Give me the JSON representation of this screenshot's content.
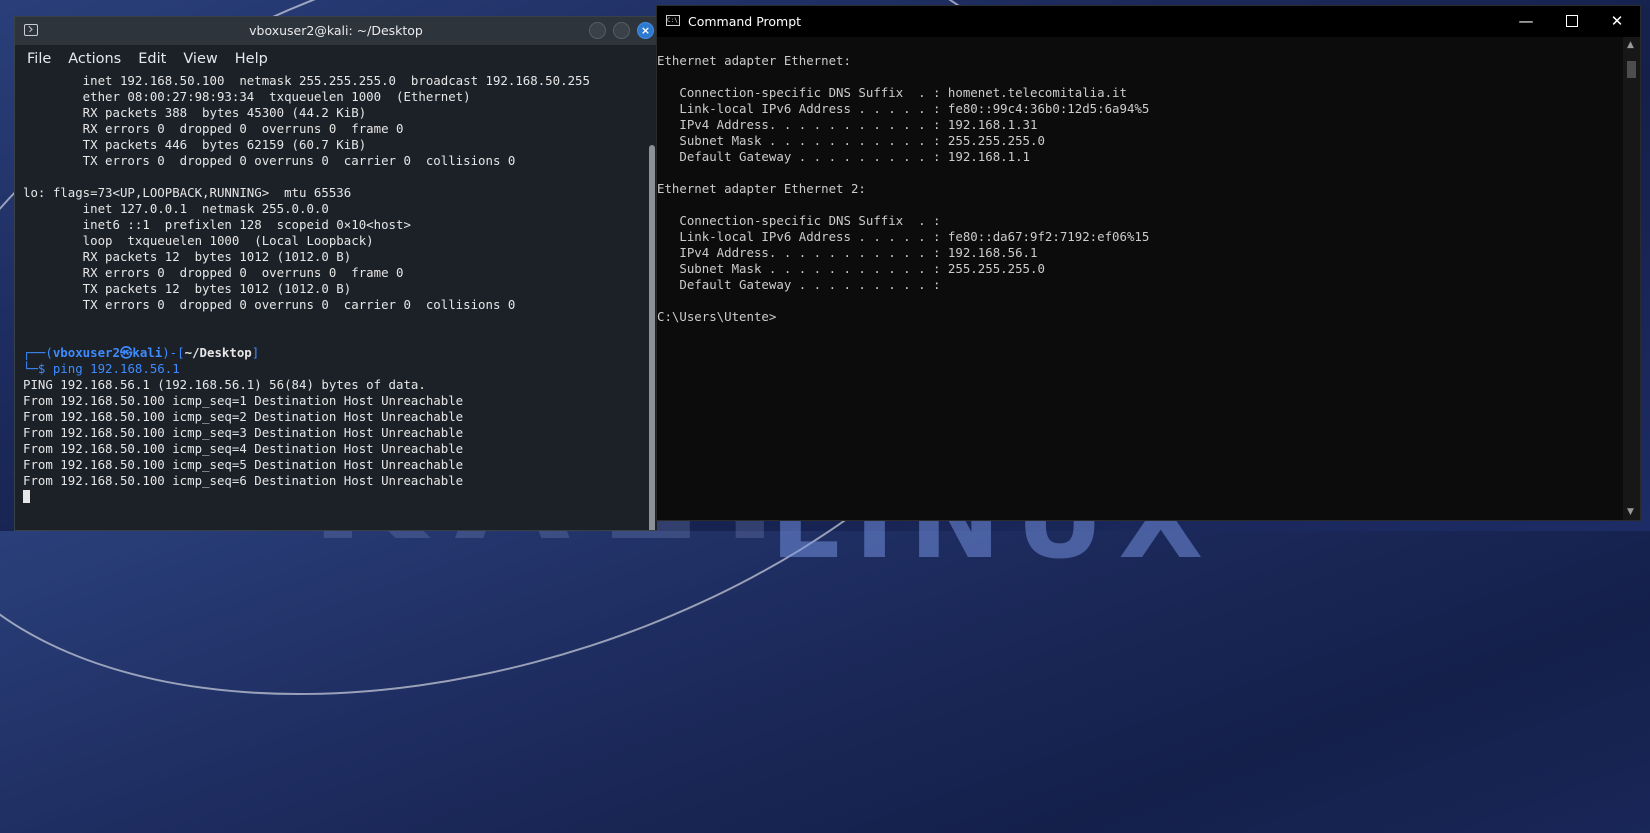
{
  "colors": {
    "kali_prompt_blue": "#3d8bff",
    "cmd_text": "#cccccc",
    "kali_bg": "#1c2128"
  },
  "desktop": {
    "brand_text": "KALI",
    "brand_text_2": "LINUX"
  },
  "kali_terminal": {
    "title": "vboxuser2@kali: ~/Desktop",
    "menu": [
      "File",
      "Actions",
      "Edit",
      "View",
      "Help"
    ],
    "lines": [
      "        inet 192.168.50.100  netmask 255.255.255.0  broadcast 192.168.50.255",
      "        ether 08:00:27:98:93:34  txqueuelen 1000  (Ethernet)",
      "        RX packets 388  bytes 45300 (44.2 KiB)",
      "        RX errors 0  dropped 0  overruns 0  frame 0",
      "        TX packets 446  bytes 62159 (60.7 KiB)",
      "        TX errors 0  dropped 0 overruns 0  carrier 0  collisions 0",
      "",
      "lo: flags=73<UP,LOOPBACK,RUNNING>  mtu 65536",
      "        inet 127.0.0.1  netmask 255.0.0.0",
      "        inet6 ::1  prefixlen 128  scopeid 0×10<host>",
      "        loop  txqueuelen 1000  (Local Loopback)",
      "        RX packets 12  bytes 1012 (1012.0 B)",
      "        RX errors 0  dropped 0  overruns 0  frame 0",
      "        TX packets 12  bytes 1012 (1012.0 B)",
      "        TX errors 0  dropped 0 overruns 0  carrier 0  collisions 0",
      "",
      ""
    ],
    "prompt": {
      "open": "┌──(",
      "user_host": "vboxuser2㉿kali",
      "mid": ")-[",
      "path": "~/Desktop",
      "close": "]",
      "line2": "└─$ ",
      "command": "ping 192.168.56.1"
    },
    "output": [
      "PING 192.168.56.1 (192.168.56.1) 56(84) bytes of data.",
      "From 192.168.50.100 icmp_seq=1 Destination Host Unreachable",
      "From 192.168.50.100 icmp_seq=2 Destination Host Unreachable",
      "From 192.168.50.100 icmp_seq=3 Destination Host Unreachable",
      "From 192.168.50.100 icmp_seq=4 Destination Host Unreachable",
      "From 192.168.50.100 icmp_seq=5 Destination Host Unreachable",
      "From 192.168.50.100 icmp_seq=6 Destination Host Unreachable"
    ]
  },
  "cmd": {
    "title": "Command Prompt",
    "icon_text": "C:\\",
    "controls": {
      "minimize": "—",
      "close": "✕"
    },
    "scroll_up": "▲",
    "scroll_down": "▼",
    "lines": [
      "Ethernet adapter Ethernet:",
      "",
      "   Connection-specific DNS Suffix  . : homenet.telecomitalia.it",
      "   Link-local IPv6 Address . . . . . : fe80::99c4:36b0:12d5:6a94%5",
      "   IPv4 Address. . . . . . . . . . . : 192.168.1.31",
      "   Subnet Mask . . . . . . . . . . . : 255.255.255.0",
      "   Default Gateway . . . . . . . . . : 192.168.1.1",
      "",
      "Ethernet adapter Ethernet 2:",
      "",
      "   Connection-specific DNS Suffix  . :",
      "   Link-local IPv6 Address . . . . . : fe80::da67:9f2:7192:ef06%15",
      "   IPv4 Address. . . . . . . . . . . : 192.168.56.1",
      "   Subnet Mask . . . . . . . . . . . : 255.255.255.0",
      "   Default Gateway . . . . . . . . . :",
      "",
      "C:\\Users\\Utente>"
    ]
  }
}
